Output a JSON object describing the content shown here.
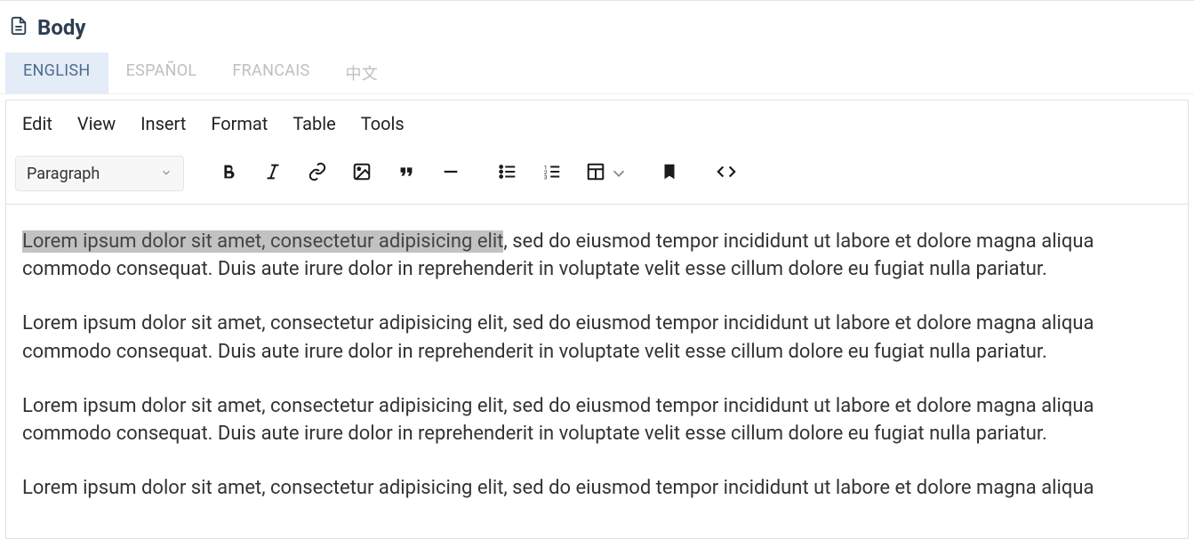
{
  "header": {
    "title": "Body"
  },
  "tabs": [
    {
      "label": "ENGLISH",
      "active": true
    },
    {
      "label": "ESPAÑOL",
      "active": false
    },
    {
      "label": "FRANCAIS",
      "active": false
    },
    {
      "label": "中文",
      "active": false
    }
  ],
  "menubar": {
    "edit": "Edit",
    "view": "View",
    "insert": "Insert",
    "format": "Format",
    "table": "Table",
    "tools": "Tools"
  },
  "toolbar": {
    "format_selector": "Paragraph"
  },
  "content": {
    "p1_highlight": "Lorem ipsum dolor sit amet, consectetur adipisicing elit",
    "p1_rest": ", sed do eiusmod tempor incididunt ut labore et dolore magna aliqua commodo consequat. Duis aute irure dolor in reprehenderit in voluptate velit esse cillum dolore eu fugiat nulla pariatur.",
    "p2": "Lorem ipsum dolor sit amet, consectetur adipisicing elit, sed do eiusmod tempor incididunt ut labore et dolore magna aliqua commodo consequat. Duis aute irure dolor in reprehenderit in voluptate velit esse cillum dolore eu fugiat nulla pariatur.",
    "p3": "Lorem ipsum dolor sit amet, consectetur adipisicing elit, sed do eiusmod tempor incididunt ut labore et dolore magna aliqua commodo consequat. Duis aute irure dolor in reprehenderit in voluptate velit esse cillum dolore eu fugiat nulla pariatur.",
    "p4": "Lorem ipsum dolor sit amet, consectetur adipisicing elit, sed do eiusmod tempor incididunt ut labore et dolore magna aliqua"
  }
}
